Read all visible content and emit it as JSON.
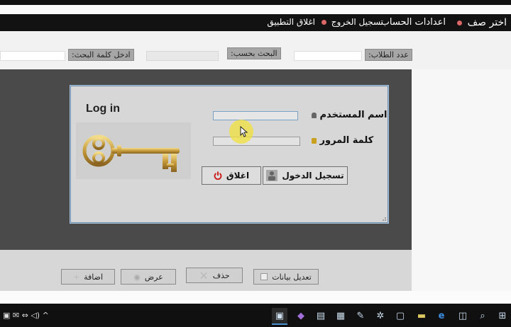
{
  "menu": {
    "select_class": "اختر صف",
    "account_settings": "اعدادات الحساب",
    "logout": "تسجيل الخروج",
    "close_app": "اغلاق التطبيق"
  },
  "search": {
    "student_count_label": "عدد الطلاب:",
    "search_by_label": "البحث بحسب:",
    "keyword_label": "ادخل كلمة البحث:"
  },
  "login": {
    "title": "Log in",
    "username_label": "اسم المستخدم",
    "password_label": "كلمة المرور",
    "login_button": "تسجيل الدخول",
    "close_button": "اغلاق"
  },
  "actions": {
    "edit": "تعديل بيانات",
    "delete": "حذف",
    "view": "عرض",
    "add": "اضافة"
  },
  "icons": [
    "user-icon",
    "lock-icon",
    "key-image",
    "power-icon",
    "login-person-icon"
  ],
  "colors": {
    "menubar": "#121212",
    "dark_panel": "#4a4a4a",
    "dialog": "#d7d7d7",
    "dialog_border": "#6e8fb0",
    "power_red": "#cc1111",
    "highlight": "#f0e13c"
  }
}
